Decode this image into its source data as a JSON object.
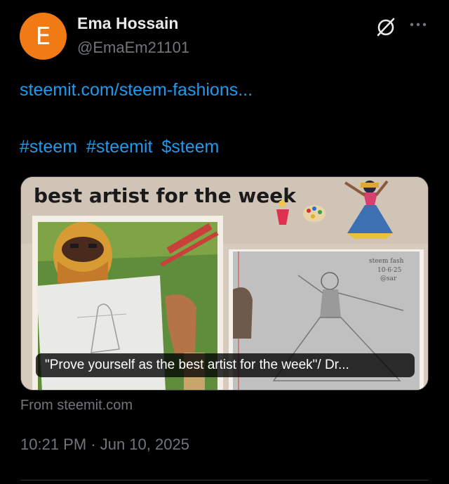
{
  "author": {
    "initial": "E",
    "name": "Ema Hossain",
    "handle": "@EmaEm21101",
    "avatar_color": "#f07a14"
  },
  "post": {
    "link": "steemit.com/steem-fashions...",
    "tags": [
      "#steem",
      "#steemit",
      "$steem"
    ]
  },
  "card": {
    "banner_text": "best artist for the week",
    "caption": "\"Prove yourself as the best artist for the week\"/ Dr...",
    "source": "From steemit.com"
  },
  "meta": {
    "timestamp": "10:21 PM · Jun 10, 2025"
  },
  "icons": [
    "grok-icon",
    "more-icon"
  ],
  "colors": {
    "link": "#1d9bf0",
    "muted": "#71767b",
    "text": "#e7e9ea",
    "background": "#000000"
  }
}
